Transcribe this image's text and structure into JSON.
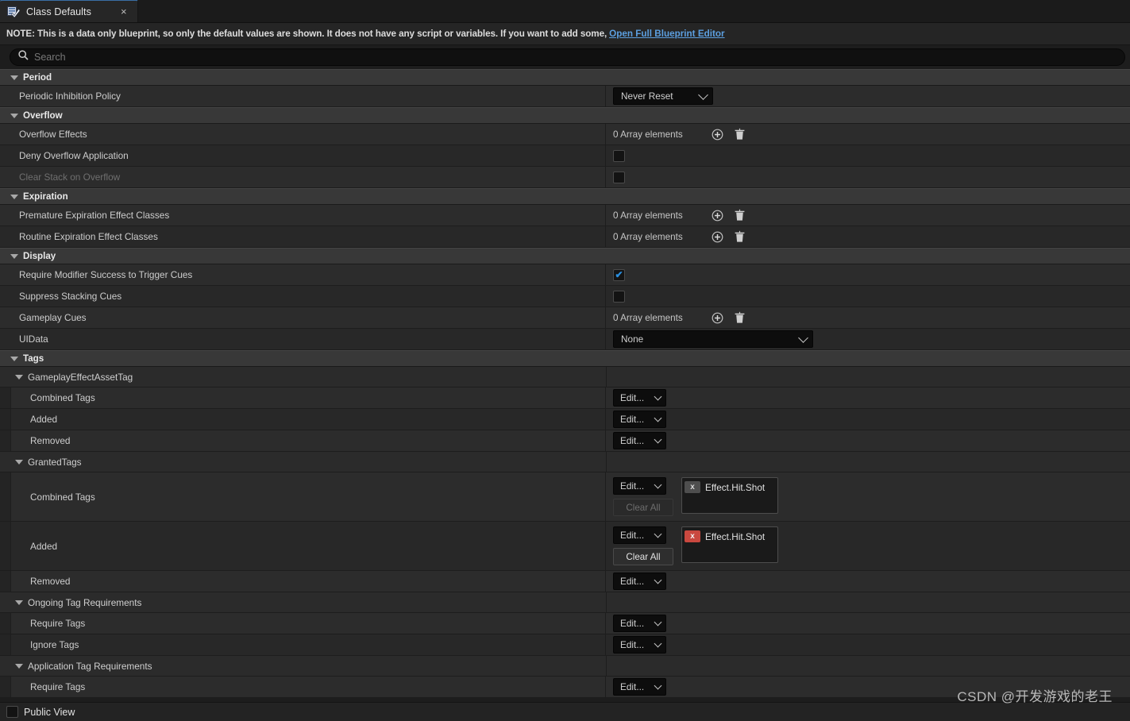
{
  "window": {
    "tab": {
      "icon": "blueprint-defaults-icon",
      "label": "Class Defaults",
      "close": "×"
    }
  },
  "note": {
    "text": "NOTE: This is a data only blueprint, so only the default values are shown.  It does not have any script or variables.  If you want to add some,",
    "link": "Open Full Blueprint Editor"
  },
  "search": {
    "icon": "search-icon",
    "placeholder": "Search",
    "value": ""
  },
  "widgets": {
    "array_elements_zero": "0 Array elements",
    "add_icon": "plus-circle-icon",
    "delete_icon": "trash-icon",
    "edit_label": "Edit...",
    "clear_all_label": "Clear All"
  },
  "sections": [
    {
      "name": "Period",
      "rows": [
        {
          "label": "Periodic Inhibition Policy",
          "widget": "combo-policy",
          "value": "Never Reset"
        }
      ]
    },
    {
      "name": "Overflow",
      "rows": [
        {
          "label": "Overflow Effects",
          "widget": "array",
          "value": "0 Array elements"
        },
        {
          "label": "Deny Overflow Application",
          "widget": "checkbox",
          "checked": false
        },
        {
          "label": "Clear Stack on Overflow",
          "widget": "checkbox",
          "checked": false,
          "disabled": true
        }
      ]
    },
    {
      "name": "Expiration",
      "rows": [
        {
          "label": "Premature Expiration Effect Classes",
          "widget": "array",
          "value": "0 Array elements"
        },
        {
          "label": "Routine Expiration Effect Classes",
          "widget": "array",
          "value": "0 Array elements"
        }
      ]
    },
    {
      "name": "Display",
      "rows": [
        {
          "label": "Require Modifier Success to Trigger Cues",
          "widget": "checkbox",
          "checked": true
        },
        {
          "label": "Suppress Stacking Cues",
          "widget": "checkbox",
          "checked": false
        },
        {
          "label": "Gameplay Cues",
          "widget": "array",
          "value": "0 Array elements"
        },
        {
          "label": "UIData",
          "widget": "combo-uidata",
          "value": "None"
        }
      ]
    },
    {
      "name": "Tags",
      "structs": [
        {
          "name": "GameplayEffectAssetTag",
          "rows": [
            {
              "label": "Combined Tags",
              "widget": "edit",
              "value": "Edit..."
            },
            {
              "label": "Added",
              "widget": "edit",
              "value": "Edit..."
            },
            {
              "label": "Removed",
              "widget": "edit",
              "value": "Edit..."
            }
          ]
        },
        {
          "name": "GrantedTags",
          "rows": [
            {
              "label": "Combined Tags",
              "widget": "edit-tags",
              "value": "Edit...",
              "clear_all": "Clear All",
              "clear_all_enabled": false,
              "tags": [
                {
                  "label": "Effect.Hit.Shot",
                  "remove": "x",
                  "remove_style": "grey"
                }
              ]
            },
            {
              "label": "Added",
              "widget": "edit-tags",
              "value": "Edit...",
              "clear_all": "Clear All",
              "clear_all_enabled": true,
              "tags": [
                {
                  "label": "Effect.Hit.Shot",
                  "remove": "x",
                  "remove_style": "red"
                }
              ]
            },
            {
              "label": "Removed",
              "widget": "edit",
              "value": "Edit..."
            }
          ]
        },
        {
          "name": "Ongoing Tag Requirements",
          "rows": [
            {
              "label": "Require Tags",
              "widget": "edit",
              "value": "Edit..."
            },
            {
              "label": "Ignore Tags",
              "widget": "edit",
              "value": "Edit..."
            }
          ]
        },
        {
          "name": "Application Tag Requirements",
          "rows": [
            {
              "label": "Require Tags",
              "widget": "edit",
              "value": "Edit..."
            }
          ]
        }
      ]
    }
  ],
  "footer": {
    "public_view_label": "Public View",
    "public_view_checked": false
  },
  "watermark": "CSDN @开发游戏的老王",
  "colors": {
    "accent_blue": "#3a6ea5",
    "link_blue": "#5c9fe0",
    "check_blue": "#2a8fe0",
    "tag_remove_red": "#c9483f",
    "panel_bg": "#242424",
    "row_bg": "#2c2c2c",
    "category_bg": "#383838"
  }
}
